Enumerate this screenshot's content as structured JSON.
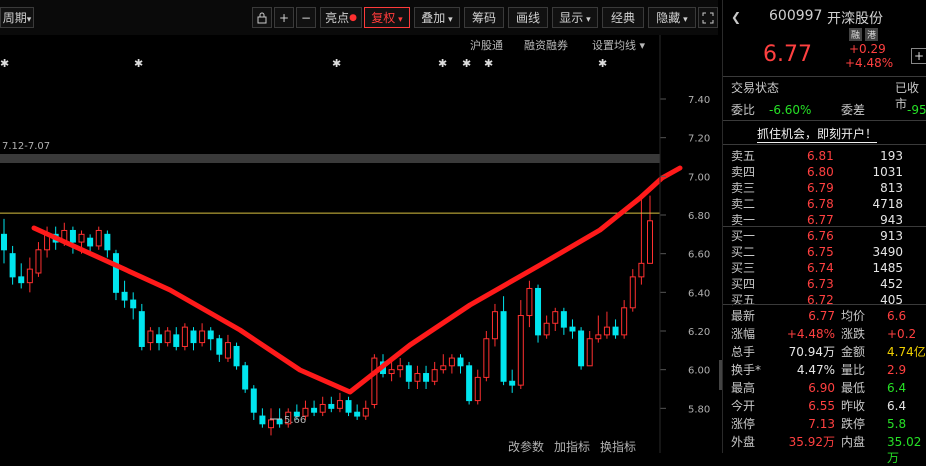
{
  "toolbar": {
    "period_label": "周期",
    "highlight_label": "亮点",
    "fuquan_label": "复权",
    "overlay_label": "叠加",
    "chip_label": "筹码",
    "draw_label": "画线",
    "display_label": "显示",
    "classic_label": "经典",
    "hide_label": "隐藏",
    "plus": "+",
    "minus": "−"
  },
  "subbar": {
    "hgt": "沪股通",
    "margin": "融资融券",
    "ma_setting": "设置均线"
  },
  "chart": {
    "date_range": "7.12-7.07",
    "low_marker": "5.66",
    "y_ticks": [
      "7.40",
      "7.20",
      "7.00",
      "6.80",
      "6.60",
      "6.40",
      "6.20",
      "6.00",
      "5.80"
    ],
    "buttons": [
      "改参数",
      "加指标",
      "换指标"
    ],
    "colors": {
      "up": "#ff3030",
      "down": "#00e5ee",
      "trend": "#ff1a1a",
      "ref_line": "#d8c040"
    }
  },
  "chart_data": {
    "type": "candlestick",
    "title": "",
    "ylim": [
      5.6,
      7.55
    ],
    "candles": [
      [
        6.7,
        6.62,
        6.78,
        6.55
      ],
      [
        6.6,
        6.48,
        6.64,
        6.44
      ],
      [
        6.48,
        6.45,
        6.55,
        6.42
      ],
      [
        6.45,
        6.52,
        6.58,
        6.4
      ],
      [
        6.5,
        6.62,
        6.66,
        6.48
      ],
      [
        6.62,
        6.7,
        6.74,
        6.58
      ],
      [
        6.7,
        6.66,
        6.74,
        6.62
      ],
      [
        6.66,
        6.72,
        6.76,
        6.64
      ],
      [
        6.72,
        6.66,
        6.74,
        6.6
      ],
      [
        6.66,
        6.7,
        6.72,
        6.6
      ],
      [
        6.68,
        6.64,
        6.7,
        6.6
      ],
      [
        6.64,
        6.72,
        6.74,
        6.62
      ],
      [
        6.7,
        6.62,
        6.72,
        6.58
      ],
      [
        6.6,
        6.4,
        6.62,
        6.36
      ],
      [
        6.4,
        6.36,
        6.46,
        6.32
      ],
      [
        6.36,
        6.32,
        6.4,
        6.26
      ],
      [
        6.3,
        6.12,
        6.34,
        6.1
      ],
      [
        6.14,
        6.2,
        6.22,
        6.1
      ],
      [
        6.18,
        6.14,
        6.22,
        6.1
      ],
      [
        6.14,
        6.2,
        6.22,
        6.12
      ],
      [
        6.18,
        6.12,
        6.22,
        6.1
      ],
      [
        6.12,
        6.22,
        6.24,
        6.1
      ],
      [
        6.2,
        6.14,
        6.22,
        6.1
      ],
      [
        6.14,
        6.2,
        6.24,
        6.12
      ],
      [
        6.2,
        6.16,
        6.22,
        6.1
      ],
      [
        6.16,
        6.08,
        6.18,
        6.04
      ],
      [
        6.06,
        6.14,
        6.18,
        6.04
      ],
      [
        6.12,
        6.02,
        6.14,
        6.0
      ],
      [
        6.02,
        5.9,
        6.04,
        5.88
      ],
      [
        5.9,
        5.78,
        5.92,
        5.74
      ],
      [
        5.76,
        5.72,
        5.8,
        5.7
      ],
      [
        5.7,
        5.74,
        5.8,
        5.66
      ],
      [
        5.74,
        5.72,
        5.8,
        5.7
      ],
      [
        5.72,
        5.78,
        5.8,
        5.7
      ],
      [
        5.78,
        5.76,
        5.82,
        5.74
      ],
      [
        5.76,
        5.8,
        5.84,
        5.74
      ],
      [
        5.8,
        5.78,
        5.84,
        5.76
      ],
      [
        5.78,
        5.82,
        5.86,
        5.76
      ],
      [
        5.82,
        5.8,
        5.86,
        5.78
      ],
      [
        5.8,
        5.84,
        5.88,
        5.78
      ],
      [
        5.84,
        5.78,
        5.86,
        5.76
      ],
      [
        5.78,
        5.76,
        5.82,
        5.74
      ],
      [
        5.76,
        5.8,
        5.84,
        5.74
      ],
      [
        5.82,
        6.06,
        6.08,
        5.8
      ],
      [
        6.04,
        5.98,
        6.08,
        5.96
      ],
      [
        5.98,
        6.0,
        6.04,
        5.94
      ],
      [
        6.0,
        6.02,
        6.06,
        5.96
      ],
      [
        6.02,
        5.94,
        6.04,
        5.9
      ],
      [
        5.94,
        5.98,
        6.02,
        5.9
      ],
      [
        5.98,
        5.94,
        6.02,
        5.9
      ],
      [
        5.94,
        6.0,
        6.04,
        5.92
      ],
      [
        6.0,
        6.02,
        6.08,
        5.98
      ],
      [
        6.02,
        6.06,
        6.08,
        5.98
      ],
      [
        6.06,
        6.02,
        6.08,
        5.98
      ],
      [
        6.02,
        5.84,
        6.04,
        5.82
      ],
      [
        5.84,
        5.96,
        6.0,
        5.82
      ],
      [
        5.96,
        6.16,
        6.2,
        5.94
      ],
      [
        6.16,
        6.3,
        6.34,
        6.12
      ],
      [
        6.3,
        5.94,
        6.38,
        5.92
      ],
      [
        5.94,
        5.92,
        6.0,
        5.88
      ],
      [
        5.92,
        6.28,
        6.36,
        5.9
      ],
      [
        6.28,
        6.42,
        6.46,
        6.22
      ],
      [
        6.42,
        6.18,
        6.44,
        6.14
      ],
      [
        6.18,
        6.24,
        6.28,
        6.16
      ],
      [
        6.24,
        6.3,
        6.32,
        6.2
      ],
      [
        6.3,
        6.22,
        6.32,
        6.18
      ],
      [
        6.22,
        6.2,
        6.26,
        6.16
      ],
      [
        6.2,
        6.02,
        6.22,
        6.0
      ],
      [
        6.02,
        6.16,
        6.2,
        6.02
      ],
      [
        6.16,
        6.18,
        6.28,
        6.14
      ],
      [
        6.18,
        6.22,
        6.3,
        6.16
      ],
      [
        6.22,
        6.18,
        6.26,
        6.16
      ],
      [
        6.18,
        6.32,
        6.36,
        6.16
      ],
      [
        6.32,
        6.48,
        6.52,
        6.3
      ],
      [
        6.48,
        6.55,
        6.9,
        6.44
      ],
      [
        6.55,
        6.77,
        6.9,
        6.55
      ]
    ]
  },
  "panel": {
    "code": "600997",
    "name": "开滦股份",
    "tags": [
      "融",
      "港"
    ],
    "price": "6.77",
    "change": "+0.29",
    "change_pct": "+4.48%",
    "plus_sign": "+",
    "trade_status_label": "交易状态",
    "trade_status": "已收市",
    "weibi_label": "委比",
    "weibi": "-6.60%",
    "weicha_label": "委差",
    "weicha": "-95",
    "promo": "抓住机会，即刻开户！",
    "sells": [
      {
        "label": "卖五",
        "price": "6.81",
        "vol": "193"
      },
      {
        "label": "卖四",
        "price": "6.80",
        "vol": "1031"
      },
      {
        "label": "卖三",
        "price": "6.79",
        "vol": "813"
      },
      {
        "label": "卖二",
        "price": "6.78",
        "vol": "4718"
      },
      {
        "label": "卖一",
        "price": "6.77",
        "vol": "943"
      }
    ],
    "buys": [
      {
        "label": "买一",
        "price": "6.76",
        "vol": "913"
      },
      {
        "label": "买二",
        "price": "6.75",
        "vol": "3490"
      },
      {
        "label": "买三",
        "price": "6.74",
        "vol": "1485"
      },
      {
        "label": "买四",
        "price": "6.73",
        "vol": "452"
      },
      {
        "label": "买五",
        "price": "6.72",
        "vol": "405"
      }
    ],
    "stats": [
      {
        "l1": "最新",
        "v1": "6.77",
        "c1": "red",
        "l2": "均价",
        "v2": "6.6",
        "c2": "red"
      },
      {
        "l1": "涨幅",
        "v1": "+4.48%",
        "c1": "red",
        "l2": "涨跌",
        "v2": "+0.2",
        "c2": "red"
      },
      {
        "l1": "总手",
        "v1": "70.94万",
        "c1": "white",
        "l2": "金额",
        "v2": "4.74亿",
        "c2": "yellow"
      },
      {
        "l1": "换手*",
        "v1": "4.47%",
        "c1": "white",
        "l2": "量比",
        "v2": "2.9",
        "c2": "red"
      },
      {
        "l1": "最高",
        "v1": "6.90",
        "c1": "red",
        "l2": "最低",
        "v2": "6.4",
        "c2": "green"
      },
      {
        "l1": "今开",
        "v1": "6.55",
        "c1": "red",
        "l2": "昨收",
        "v2": "6.4",
        "c2": "white"
      },
      {
        "l1": "涨停",
        "v1": "7.13",
        "c1": "red",
        "l2": "跌停",
        "v2": "5.8",
        "c2": "green"
      },
      {
        "l1": "外盘",
        "v1": "35.92万",
        "c1": "red",
        "l2": "内盘",
        "v2": "35.02万",
        "c2": "green"
      }
    ]
  }
}
